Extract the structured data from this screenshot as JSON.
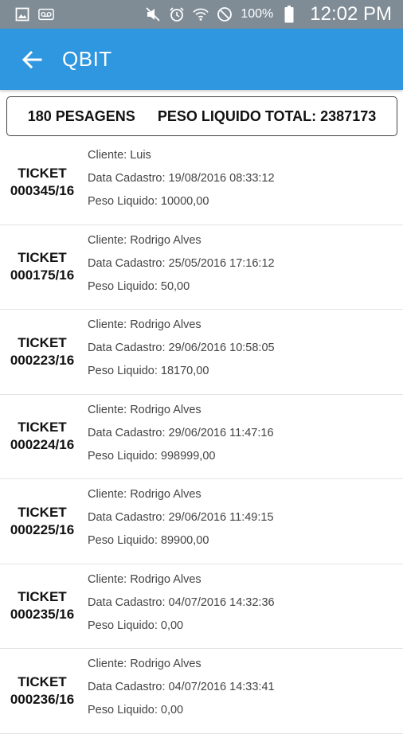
{
  "status_bar": {
    "battery_percent": "100%",
    "time": "12:02 PM"
  },
  "app_bar": {
    "title": "QBIT"
  },
  "summary": {
    "pesagens": "180 PESAGENS",
    "peso_total": "PESO LIQUIDO TOTAL: 2387173"
  },
  "tickets": [
    {
      "label": "TICKET",
      "number": "000345/16",
      "cliente": "Cliente: Luis",
      "data": "Data Cadastro: 19/08/2016 08:33:12",
      "peso": "Peso Liquido: 10000,00"
    },
    {
      "label": "TICKET",
      "number": "000175/16",
      "cliente": "Cliente: Rodrigo Alves",
      "data": "Data Cadastro: 25/05/2016 17:16:12",
      "peso": "Peso Liquido: 50,00"
    },
    {
      "label": "TICKET",
      "number": "000223/16",
      "cliente": "Cliente: Rodrigo Alves",
      "data": "Data Cadastro: 29/06/2016 10:58:05",
      "peso": "Peso Liquido: 18170,00"
    },
    {
      "label": "TICKET",
      "number": "000224/16",
      "cliente": "Cliente: Rodrigo Alves",
      "data": "Data Cadastro: 29/06/2016 11:47:16",
      "peso": "Peso Liquido: 998999,00"
    },
    {
      "label": "TICKET",
      "number": "000225/16",
      "cliente": "Cliente: Rodrigo Alves",
      "data": "Data Cadastro: 29/06/2016 11:49:15",
      "peso": "Peso Liquido: 89900,00"
    },
    {
      "label": "TICKET",
      "number": "000235/16",
      "cliente": "Cliente: Rodrigo Alves",
      "data": "Data Cadastro: 04/07/2016 14:32:36",
      "peso": "Peso Liquido: 0,00"
    },
    {
      "label": "TICKET",
      "number": "000236/16",
      "cliente": "Cliente: Rodrigo Alves",
      "data": "Data Cadastro: 04/07/2016 14:33:41",
      "peso": "Peso Liquido: 0,00"
    }
  ],
  "colors": {
    "status_bar": "#7f8c96",
    "app_bar": "#2f96e0"
  },
  "icons": [
    "image-icon",
    "voicemail-icon",
    "mute-icon",
    "alarm-icon",
    "wifi-icon",
    "do-not-disturb-icon",
    "battery-icon",
    "back-arrow-icon"
  ]
}
